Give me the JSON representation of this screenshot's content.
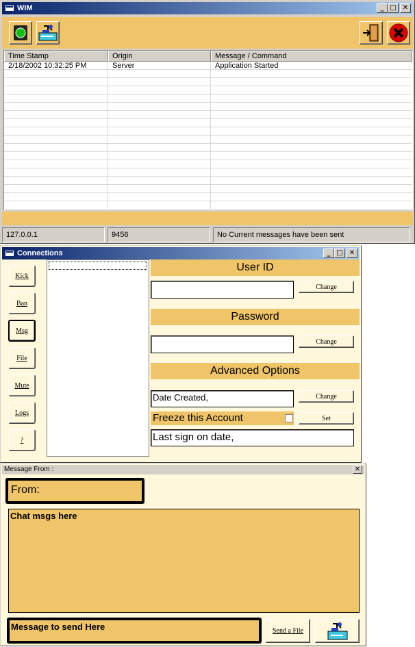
{
  "wim": {
    "title": "WIM",
    "columns": [
      "Time Stamp",
      "Origin",
      "Message / Command"
    ],
    "rows": [
      {
        "time": "2/18/2002 10:32:25 PM",
        "origin": "Server",
        "message": "Application Started"
      }
    ],
    "status": {
      "ip": "127.0.0.1",
      "port": "9456",
      "message": "No Current messages have been sent"
    }
  },
  "connections": {
    "title": "Connections",
    "side_buttons": [
      "Kick",
      "Ban",
      "Msg",
      "File",
      "Mute",
      "Logs",
      "?"
    ],
    "active_button": "Msg",
    "user_id_header": "User ID",
    "password_header": "Password",
    "advanced_header": "Advanced Options",
    "user_id_value": "",
    "password_value": "",
    "date_created": "Date Created,",
    "freeze_label": "Freeze this Account",
    "freeze_checked": false,
    "last_sign_on": "Last sign on date,",
    "change_label": "Change",
    "set_label": "Set"
  },
  "message": {
    "title": "Message From :",
    "from_label": "From:",
    "chat_text": "Chat msgs here",
    "send_text": "Message to send Here",
    "send_file_label": "Send a File"
  },
  "icons": {
    "connect": "green-light-icon",
    "send": "computer-send-icon",
    "exit": "exit-door-icon",
    "close": "red-x-close-icon"
  },
  "colors": {
    "gold": "#f0c468",
    "cream": "#fff8dc",
    "titlebar": "#0a246a",
    "red": "#e00000"
  }
}
